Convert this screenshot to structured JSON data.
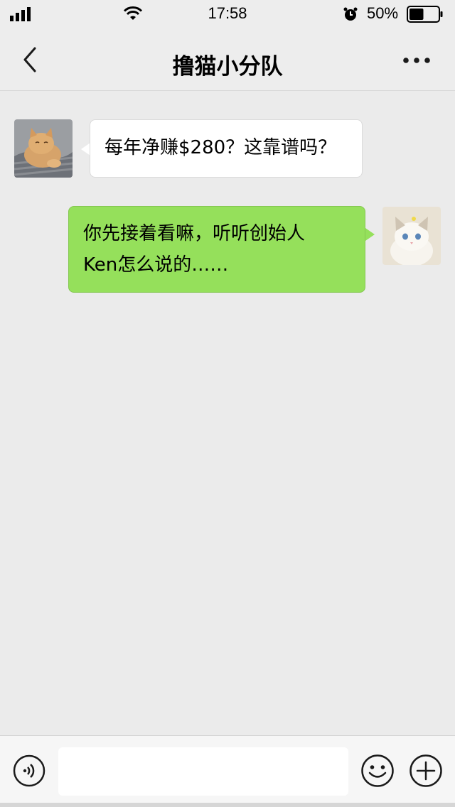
{
  "status_bar": {
    "time": "17:58",
    "battery_percent": "50%",
    "battery_level": 0.5
  },
  "nav": {
    "title": "撸猫小分队",
    "back_icon": "chevron-left-icon",
    "more_icon": "more-dots-icon"
  },
  "messages": [
    {
      "direction": "incoming",
      "text": "每年净赚$280？这靠谱吗？",
      "avatar": "orange-cat-avatar",
      "bubble_color": "#ffffff"
    },
    {
      "direction": "outgoing",
      "text_line1": "你先接着看嘛，听听创始人",
      "text_line2": "Ken怎么说的……",
      "avatar": "white-cat-avatar",
      "bubble_color": "#95e05b"
    }
  ],
  "input_bar": {
    "placeholder": "",
    "voice_icon": "voice-icon",
    "emoji_icon": "emoji-icon",
    "plus_icon": "plus-icon"
  }
}
